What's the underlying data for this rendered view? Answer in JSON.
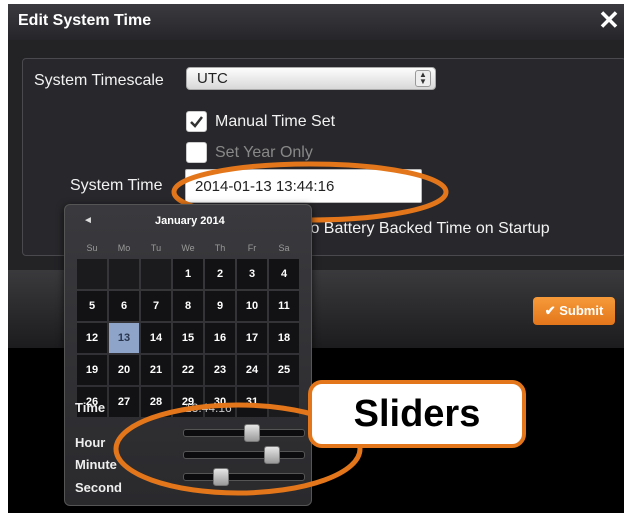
{
  "dialog": {
    "title": "Edit System Time",
    "close_icon": "close-icon"
  },
  "form": {
    "timescale_label": "System Timescale",
    "timescale_value": "UTC",
    "manual_time_label": "Manual Time Set",
    "manual_time_checked": true,
    "set_year_label": "Set Year Only",
    "set_year_checked": false,
    "system_time_label": "System Time",
    "system_time_value": "2014-01-13 13:44:16",
    "battery_label": "to Battery Backed Time on Startup"
  },
  "submit_label": "Submit",
  "calendar": {
    "title": "January 2014",
    "weekdays": [
      "Su",
      "Mo",
      "Tu",
      "We",
      "Th",
      "Fr",
      "Sa"
    ],
    "selected_day": "13",
    "days": [
      "",
      "",
      "",
      "1",
      "2",
      "3",
      "4",
      "5",
      "6",
      "7",
      "8",
      "9",
      "10",
      "11",
      "12",
      "13",
      "14",
      "15",
      "16",
      "17",
      "18",
      "19",
      "20",
      "21",
      "22",
      "23",
      "24",
      "25",
      "26",
      "27",
      "28",
      "29",
      "30",
      "31",
      ""
    ]
  },
  "time_panel": {
    "time_label": "Time",
    "time_value": "13:44:16",
    "hour_label": "Hour",
    "minute_label": "Minute",
    "second_label": "Second",
    "hour_fraction": 0.57,
    "minute_fraction": 0.75,
    "second_fraction": 0.27
  },
  "annotation": {
    "callout_text": "Sliders",
    "highlight_color": "#e3761a"
  }
}
